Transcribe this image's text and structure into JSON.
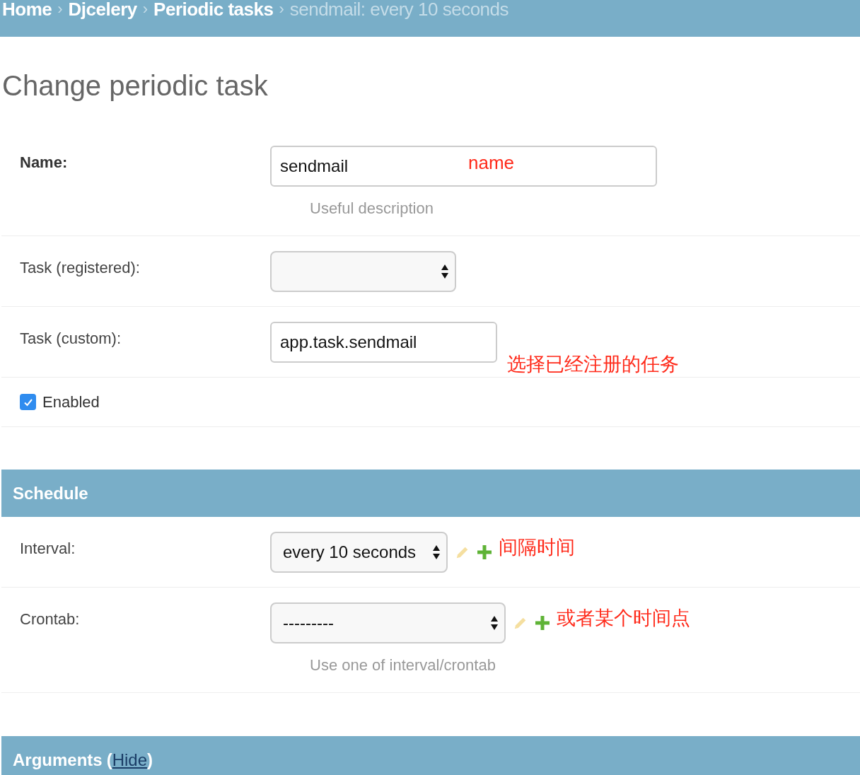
{
  "breadcrumb_separator": "›",
  "breadcrumbs": [
    {
      "label": "Home",
      "kind": "link"
    },
    {
      "label": "Djcelery",
      "kind": "link"
    },
    {
      "label": "Periodic tasks",
      "kind": "link"
    },
    {
      "label": "sendmail: every 10 seconds",
      "kind": "current"
    }
  ],
  "title": "Change periodic task",
  "general": {
    "fields": [
      {
        "kind": "text",
        "label": "Name:",
        "required": true,
        "value": "sendmail",
        "help": "Useful description",
        "annotation": "name",
        "actions": false
      },
      {
        "kind": "select",
        "label": "Task (registered):",
        "required": false,
        "actions": false
      },
      {
        "kind": "text",
        "label": "Task (custom):",
        "required": false,
        "value": "app.task.sendmail",
        "annotation": "选择已经注册的任务",
        "actions": false
      },
      {
        "kind": "checkbox",
        "label": "Enabled",
        "checked": true
      }
    ]
  },
  "schedule": {
    "heading": "Schedule",
    "fields": [
      {
        "kind": "select",
        "label": "Interval:",
        "required": false,
        "value": "every 10 seconds",
        "annotation": "间隔时间",
        "actions": true
      },
      {
        "kind": "select",
        "label": "Crontab:",
        "required": false,
        "value": "---------",
        "help": "Use one of interval/crontab",
        "annotation": "或者某个时间点",
        "actions": true
      }
    ]
  },
  "arguments": {
    "heading": "Arguments",
    "toggle_open": "(",
    "toggle": "Hide",
    "toggle_close": ")"
  }
}
